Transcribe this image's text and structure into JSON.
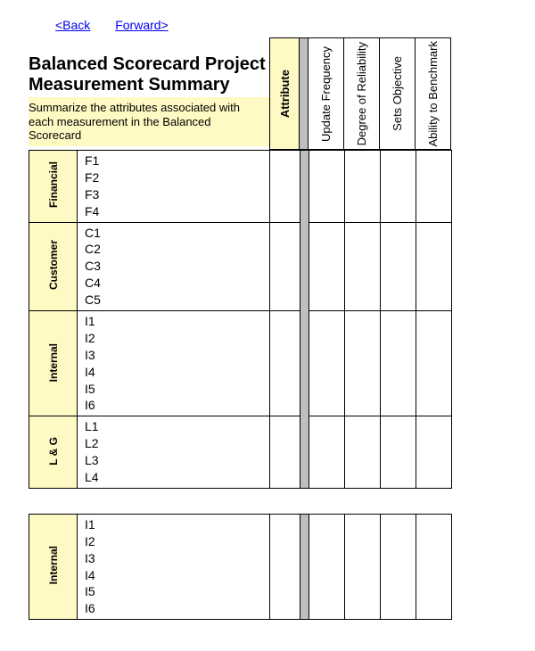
{
  "nav": {
    "back": "<Back",
    "forward": "Forward>"
  },
  "title_line1": "Balanced Scorecard Project",
  "title_line2": "Measurement Summary",
  "subtitle": "Summarize the attributes associated with each measurement in the Balanced Scorecard",
  "columns": {
    "attribute": "Attribute",
    "update_freq": "Update Frequency",
    "reliability": "Degree of Reliability",
    "sets_obj": "Sets Objective",
    "benchmark": "Ability to Benchmark"
  },
  "groups1": [
    {
      "name": "Financial",
      "items": [
        "F1",
        "F2",
        "F3",
        "F4"
      ]
    },
    {
      "name": "Customer",
      "items": [
        "C1",
        "C2",
        "C3",
        "C4",
        "C5"
      ]
    },
    {
      "name": "Internal",
      "items": [
        "I1",
        "I2",
        "I3",
        "I4",
        "I5",
        "I6"
      ]
    },
    {
      "name": "L & G",
      "items": [
        "L1",
        "L2",
        "L3",
        "L4"
      ]
    }
  ],
  "groups2": [
    {
      "name": "Internal",
      "items": [
        "I1",
        "I2",
        "I3",
        "I4",
        "I5",
        "I6"
      ]
    }
  ]
}
